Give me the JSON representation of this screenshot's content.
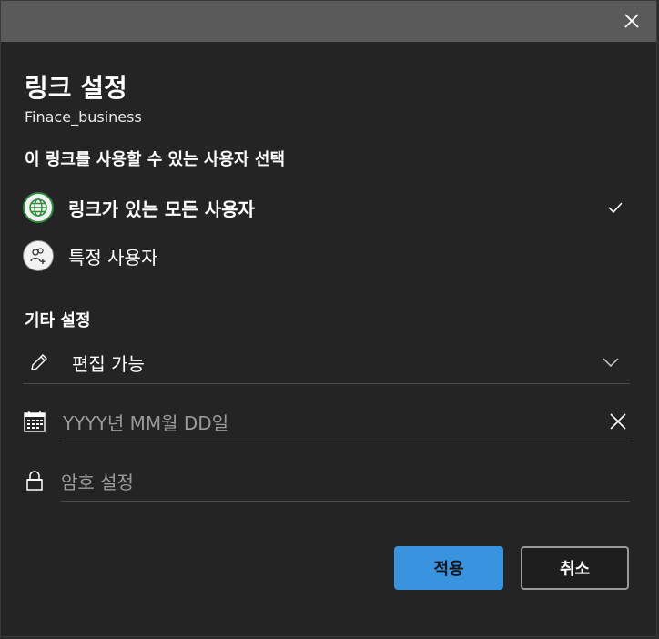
{
  "dialog": {
    "title": "링크 설정",
    "file_name": "Finace_business"
  },
  "audience": {
    "heading": "이 링크를 사용할 수 있는 사용자 선택",
    "options": [
      {
        "label": "링크가 있는 모든 사용자",
        "icon": "globe-icon",
        "selected": true
      },
      {
        "label": "특정 사용자",
        "icon": "people-add-icon",
        "selected": false
      }
    ]
  },
  "other_settings": {
    "heading": "기타 설정",
    "permission": {
      "value": "편집 가능",
      "icon": "pencil-icon"
    },
    "expiration": {
      "placeholder": "YYYY년 MM월 DD일",
      "icon": "calendar-icon"
    },
    "password": {
      "placeholder": "암호 설정",
      "icon": "lock-icon"
    }
  },
  "buttons": {
    "apply": "적용",
    "cancel": "취소"
  },
  "colors": {
    "primary": "#3a93de",
    "selected_ring": "#2e8b3e"
  }
}
